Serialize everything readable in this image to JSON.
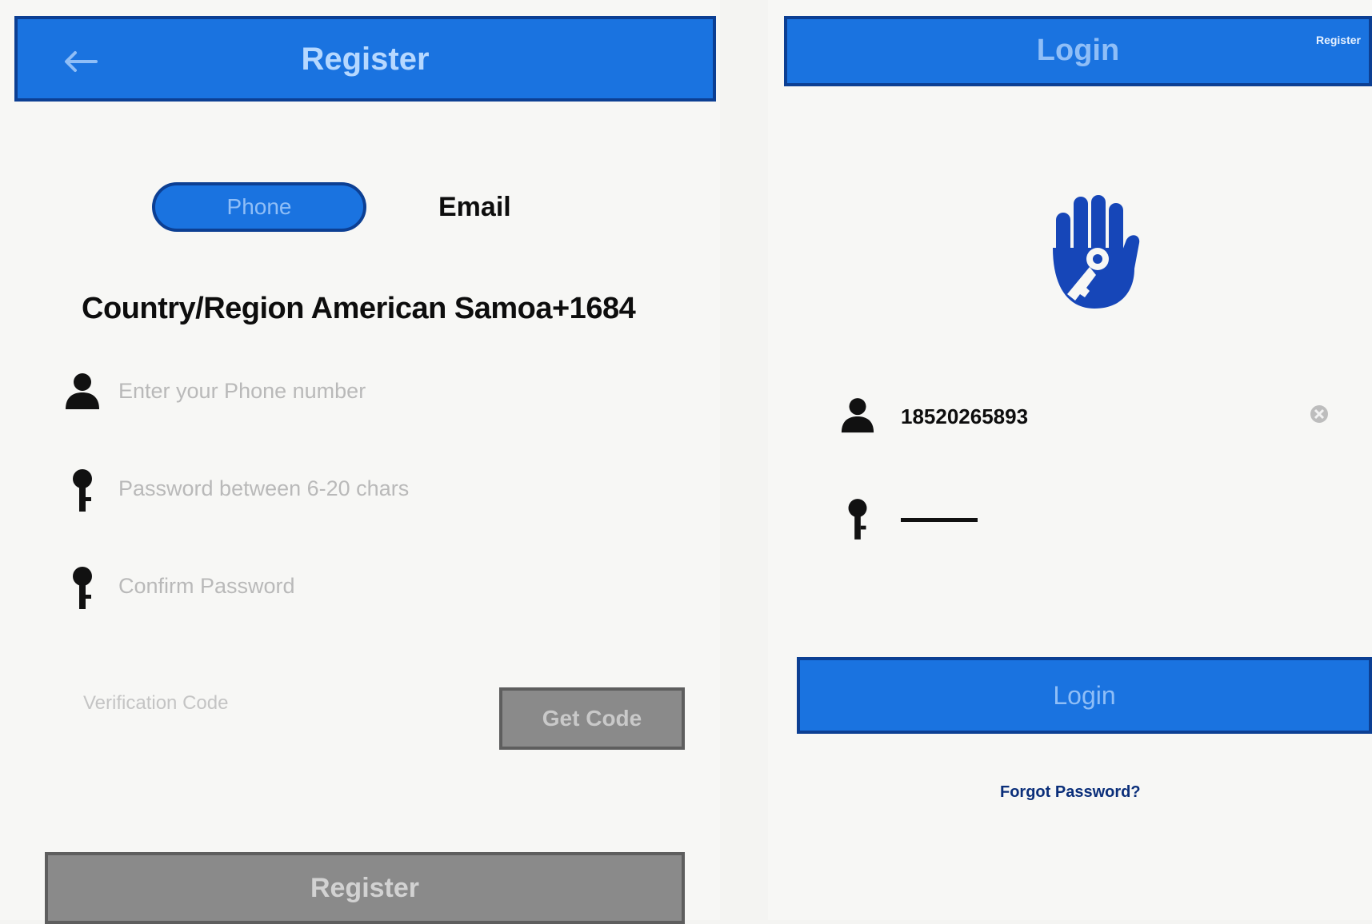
{
  "register_screen": {
    "title": "Register",
    "tabs": {
      "phone": "Phone",
      "email": "Email"
    },
    "country_region": "Country/Region American Samoa+1684",
    "fields": {
      "phone_placeholder": "Enter your Phone number",
      "password_placeholder": "Password between 6-20 chars",
      "confirm_placeholder": "Confirm Password"
    },
    "verification_label": "Verification Code",
    "get_code_label": "Get Code",
    "register_button": "Register"
  },
  "login_screen": {
    "title": "Login",
    "register_link": "Register",
    "username_value": "18520265893",
    "login_button": "Login",
    "forgot_password": "Forgot Password?"
  },
  "colors": {
    "primary": "#1a73e0",
    "primary_border": "#0c3f93",
    "disabled": "#8a8a8a",
    "text_dark": "#0d0d0d",
    "link": "#0b2f7a"
  },
  "icons": {
    "back": "arrow-left",
    "user": "user-silhouette",
    "password": "key",
    "clear": "clear-circle",
    "logo": "hand-with-key"
  }
}
